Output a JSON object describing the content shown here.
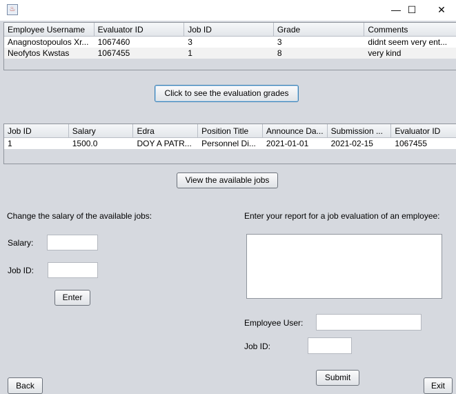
{
  "window": {
    "icon": "java-app-icon",
    "minimize": "—",
    "maximize": "☐",
    "close": "✕"
  },
  "grades_table": {
    "columns": [
      "Employee Username",
      "Evaluator ID",
      "Job ID",
      "Grade",
      "Comments"
    ],
    "rows": [
      [
        "Anagnostopoulos Xr...",
        "1067460",
        "3",
        "3",
        "didnt seem very ent..."
      ],
      [
        "Neofytos Kwstas",
        "1067455",
        "1",
        "8",
        "very kind"
      ]
    ]
  },
  "grades_button": "Click to see the evaluation grades",
  "jobs_table": {
    "columns": [
      "Job ID",
      "Salary",
      "Edra",
      "Position Title",
      "Announce Da...",
      "Submission ...",
      "Evaluator ID"
    ],
    "rows": [
      [
        "1",
        "1500.0",
        "DOY A PATR...",
        "Personnel Di...",
        "2021-01-01",
        "2021-02-15",
        "1067455"
      ]
    ]
  },
  "jobs_button": "View the available jobs",
  "salary_section": {
    "heading": "Change the salary of the available jobs:",
    "salary_label": "Salary:",
    "salary_value": "",
    "jobid_label": "Job ID:",
    "jobid_value": "",
    "enter": "Enter"
  },
  "report_section": {
    "heading": "Enter your report for a job evaluation of an employee:",
    "report_value": "",
    "employee_label": "Employee User:",
    "employee_value": "",
    "jobid_label": "Job ID:",
    "jobid_value": "",
    "submit": "Submit"
  },
  "back": "Back",
  "exit": "Exit"
}
